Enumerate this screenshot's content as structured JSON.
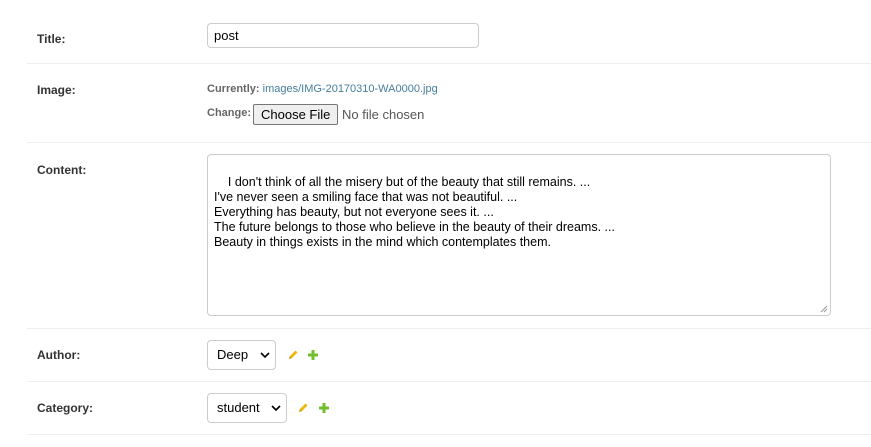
{
  "fields": {
    "title": {
      "label": "Title:",
      "value": "post"
    },
    "image": {
      "label": "Image:",
      "currently_label": "Currently:",
      "current_file": "images/IMG-20170310-WA0000.jpg",
      "change_label": "Change:",
      "choose_button": "Choose File",
      "no_file_text": "No file chosen"
    },
    "content": {
      "label": "Content:",
      "value": "I don't think of all the misery but of the beauty that still remains. ...\nI've never seen a smiling face that was not beautiful. ...\nEverything has beauty, but not everyone sees it. ...\nThe future belongs to those who believe in the beauty of their dreams. ...\nBeauty in things exists in the mind which contemplates them."
    },
    "author": {
      "label": "Author:",
      "selected": "Deep"
    },
    "category": {
      "label": "Category:",
      "selected": "student"
    }
  },
  "icons": {
    "edit": "pencil-icon",
    "add": "plus-icon"
  },
  "colors": {
    "link": "#447e9b",
    "edit_icon": "#efb80b",
    "add_icon": "#70bf2b",
    "label": "#333333"
  }
}
